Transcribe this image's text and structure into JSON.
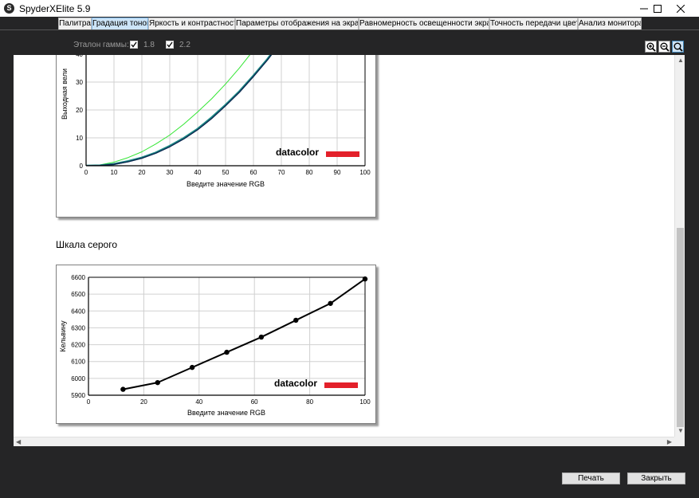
{
  "window": {
    "title": "SpyderXElite 5.9",
    "icon_letter": "S"
  },
  "tabs": [
    {
      "label": "Палитра"
    },
    {
      "label": "Градация тонов"
    },
    {
      "label": "Яркость и контрастность"
    },
    {
      "label": "Параметры отображения на экране"
    },
    {
      "label": "Равномерность освещенности экрана"
    },
    {
      "label": "Точность передачи цвета"
    },
    {
      "label": "Анализ монитора"
    }
  ],
  "active_tab": "Градация тонов",
  "toolbar": {
    "gamma_label": "Эталон гаммы:",
    "gamma_options": [
      {
        "label": "1.8",
        "checked": true
      },
      {
        "label": "2.2",
        "checked": true
      }
    ],
    "zoom_icons": [
      "zoom-in-icon",
      "zoom-out-icon",
      "zoom-fit-icon"
    ]
  },
  "section_title": "Шкала серого",
  "buttons": {
    "print": "Печать",
    "close": "Закрыть"
  },
  "colors": {
    "curve_green": "#32e632",
    "curve_teal": "#1d8a86",
    "curve_navy": "#0c2850",
    "datacolor_red": "#e3202a"
  },
  "chart_data": [
    {
      "type": "line",
      "title": "",
      "xlabel": "Введите значение RGB",
      "ylabel": "Выходная вели",
      "xlim": [
        0,
        100
      ],
      "ylim": [
        0,
        50
      ],
      "xticks": [
        0,
        10,
        20,
        30,
        40,
        50,
        60,
        70,
        80,
        90,
        100
      ],
      "yticks": [
        0,
        10,
        20,
        30,
        40
      ],
      "grid": true,
      "watermark": "datacolor",
      "series": [
        {
          "color": "#32e632",
          "x": [
            0,
            5,
            10,
            15,
            20,
            25,
            30,
            35,
            40,
            45,
            50,
            55,
            60,
            65,
            67
          ],
          "y": [
            0,
            0.3,
            1.3,
            2.9,
            5.0,
            7.8,
            11.0,
            14.9,
            19.3,
            24.0,
            29.3,
            35.1,
            41.4,
            48.2,
            51
          ]
        },
        {
          "color": "#1d8a86",
          "x": [
            0,
            5,
            10,
            15,
            20,
            25,
            30,
            35,
            40,
            45,
            50,
            55,
            60,
            65,
            70,
            72
          ],
          "y": [
            0,
            0.1,
            0.6,
            1.6,
            2.9,
            4.7,
            7.1,
            9.9,
            13.2,
            17.3,
            21.8,
            26.7,
            32.3,
            38.2,
            44.8,
            48
          ]
        },
        {
          "color": "#0c2850",
          "x": [
            0,
            5,
            10,
            15,
            20,
            25,
            30,
            35,
            40,
            45,
            50,
            55,
            60,
            65,
            70,
            72
          ],
          "y": [
            0,
            0.1,
            0.5,
            1.4,
            2.7,
            4.5,
            6.8,
            9.6,
            12.9,
            16.9,
            21.5,
            26.4,
            32.0,
            37.9,
            44.5,
            47.7
          ]
        }
      ]
    },
    {
      "type": "line",
      "title": "",
      "xlabel": "Введите значение RGB",
      "ylabel": "Кельвину",
      "xlim": [
        0,
        100
      ],
      "ylim": [
        5900,
        6600
      ],
      "xticks": [
        0,
        20,
        40,
        60,
        80,
        100
      ],
      "yticks": [
        5900,
        6000,
        6100,
        6200,
        6300,
        6400,
        6500,
        6600
      ],
      "grid": true,
      "watermark": "datacolor",
      "series": [
        {
          "color": "#000000",
          "x": [
            12.5,
            25,
            37.5,
            50,
            62.5,
            75,
            87.5,
            100
          ],
          "y": [
            5935,
            5975,
            6065,
            6155,
            6245,
            6345,
            6445,
            6590
          ]
        }
      ]
    }
  ]
}
